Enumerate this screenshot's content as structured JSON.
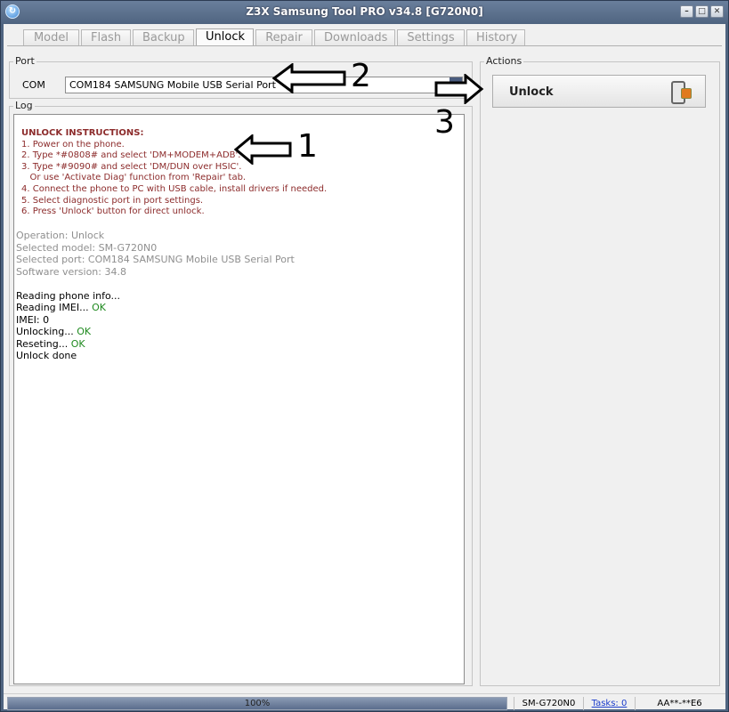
{
  "window": {
    "title": "Z3X Samsung Tool PRO v34.8 [G720N0]"
  },
  "tabs": [
    {
      "label": "Model",
      "active": false
    },
    {
      "label": "Flash",
      "active": false
    },
    {
      "label": "Backup",
      "active": false
    },
    {
      "label": "Unlock",
      "active": true
    },
    {
      "label": "Repair",
      "active": false
    },
    {
      "label": "Downloads",
      "active": false
    },
    {
      "label": "Settings",
      "active": false
    },
    {
      "label": "History",
      "active": false
    }
  ],
  "port": {
    "group_label": "Port",
    "com_label": "COM",
    "selected": "COM184 SAMSUNG Mobile USB Serial Port"
  },
  "log": {
    "group_label": "Log",
    "instructions_title": "UNLOCK INSTRUCTIONS:",
    "instructions": [
      "1. Power on the phone.",
      "2. Type *#0808# and select 'DM+MODEM+ADB'.",
      "3. Type *#9090# and select 'DM/DUN over HSIC'.",
      "   Or use 'Activate Diag' function from 'Repair' tab.",
      "4. Connect the phone to PC with USB cable, install drivers if needed.",
      "5. Select diagnostic port in port settings.",
      "6. Press 'Unlock' button for direct unlock."
    ],
    "info": [
      "Operation: Unlock",
      "Selected model: SM-G720N0",
      "Selected port: COM184 SAMSUNG Mobile USB Serial Port",
      "Software version: 34.8"
    ],
    "results": [
      {
        "text": "Reading phone info...",
        "status": ""
      },
      {
        "text": "Reading IMEI... ",
        "status": "OK"
      },
      {
        "text": "IMEI: 0",
        "status": ""
      },
      {
        "text": "Unlocking... ",
        "status": "OK"
      },
      {
        "text": "Reseting... ",
        "status": "OK"
      },
      {
        "text": "Unlock done",
        "status": ""
      }
    ]
  },
  "actions": {
    "group_label": "Actions",
    "unlock_label": "Unlock"
  },
  "status": {
    "progress_percent": 100,
    "progress_label": "100%",
    "model": "SM-G720N0",
    "tasks": "Tasks: 0",
    "code": "AA**-**E6"
  },
  "annotations": {
    "one": "1",
    "two": "2",
    "three": "3"
  },
  "colors": {
    "instructions": "#8c2b2b",
    "ok": "#1f8a1f",
    "info": "#8f8f8f",
    "titlebar": "#4f6480"
  }
}
